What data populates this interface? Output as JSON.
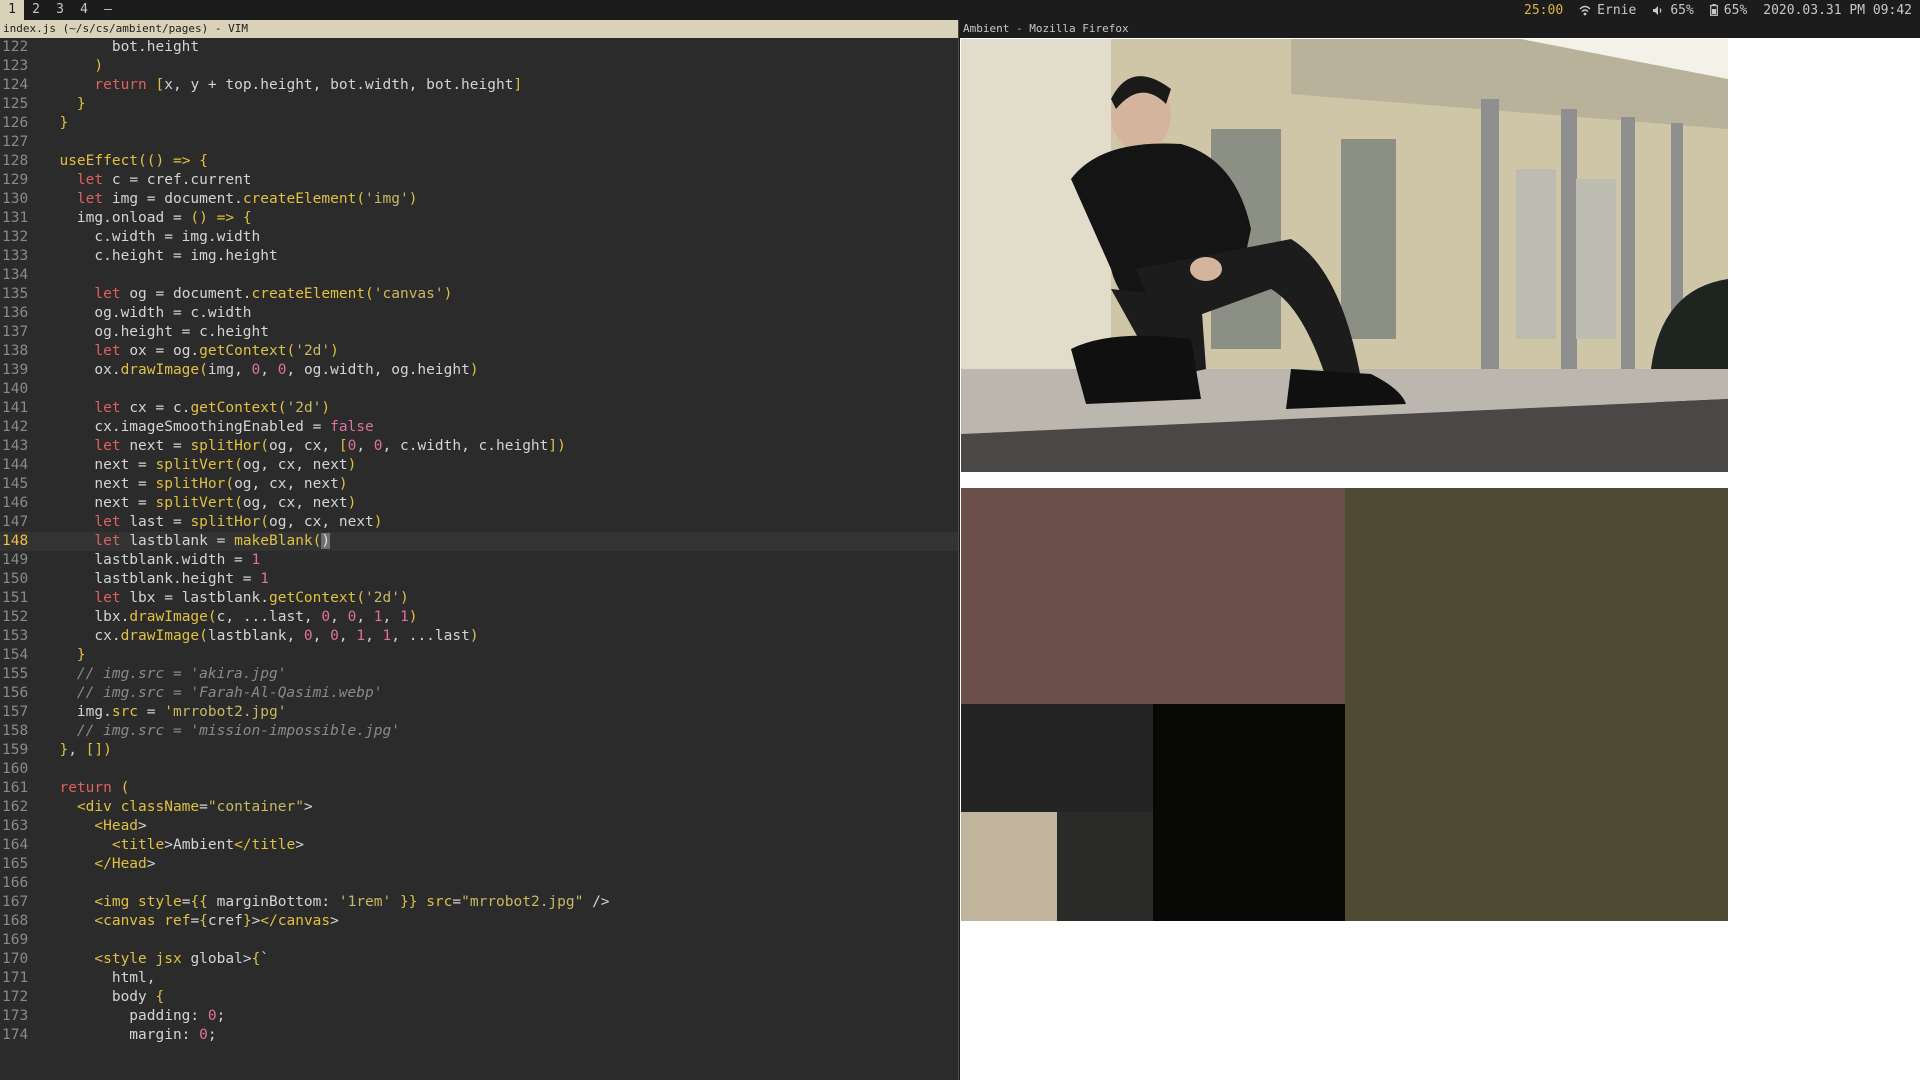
{
  "topbar": {
    "workspaces": [
      "1",
      "2",
      "3",
      "4",
      "–"
    ],
    "timer": "25:00",
    "wifi": "Ernie",
    "volume": "65%",
    "battery": "65%",
    "datetime": "2020.03.31  PM 09:42"
  },
  "vim": {
    "title": "index.js (~/s/cs/ambient/pages) - VIM",
    "current_line": "148"
  },
  "firefox": {
    "title": "Ambient - Mozilla Firefox",
    "image_alt": "mrrobot2.jpg"
  },
  "colors": {
    "accent_yellow": "#d8b545",
    "titlebar_light": "#d9d2b8",
    "block_rose": "#6b4f4a",
    "block_olive": "#4f4a33",
    "block_dark": "#242424",
    "block_black": "#080806",
    "block_beige": "#c0b49c",
    "block_charcoal": "#2a2a28"
  },
  "code_lines": [
    {
      "n": "122",
      "t": "        bot.height"
    },
    {
      "n": "123",
      "t": "      )"
    },
    {
      "n": "124",
      "t": "      return [x, y + top.height, bot.width, bot.height]"
    },
    {
      "n": "125",
      "t": "    }"
    },
    {
      "n": "126",
      "t": "  }"
    },
    {
      "n": "127",
      "t": ""
    },
    {
      "n": "128",
      "t": "  useEffect(() => {"
    },
    {
      "n": "129",
      "t": "    let c = cref.current"
    },
    {
      "n": "130",
      "t": "    let img = document.createElement('img')"
    },
    {
      "n": "131",
      "t": "    img.onload = () => {"
    },
    {
      "n": "132",
      "t": "      c.width = img.width"
    },
    {
      "n": "133",
      "t": "      c.height = img.height"
    },
    {
      "n": "134",
      "t": ""
    },
    {
      "n": "135",
      "t": "      let og = document.createElement('canvas')"
    },
    {
      "n": "136",
      "t": "      og.width = c.width"
    },
    {
      "n": "137",
      "t": "      og.height = c.height"
    },
    {
      "n": "138",
      "t": "      let ox = og.getContext('2d')"
    },
    {
      "n": "139",
      "t": "      ox.drawImage(img, 0, 0, og.width, og.height)"
    },
    {
      "n": "140",
      "t": ""
    },
    {
      "n": "141",
      "t": "      let cx = c.getContext('2d')"
    },
    {
      "n": "142",
      "t": "      cx.imageSmoothingEnabled = false"
    },
    {
      "n": "143",
      "t": "      let next = splitHor(og, cx, [0, 0, c.width, c.height])"
    },
    {
      "n": "144",
      "t": "      next = splitVert(og, cx, next)"
    },
    {
      "n": "145",
      "t": "      next = splitHor(og, cx, next)"
    },
    {
      "n": "146",
      "t": "      next = splitVert(og, cx, next)"
    },
    {
      "n": "147",
      "t": "      let last = splitHor(og, cx, next)"
    },
    {
      "n": "148",
      "t": "      let lastblank = makeBlank()"
    },
    {
      "n": "149",
      "t": "      lastblank.width = 1"
    },
    {
      "n": "150",
      "t": "      lastblank.height = 1"
    },
    {
      "n": "151",
      "t": "      let lbx = lastblank.getContext('2d')"
    },
    {
      "n": "152",
      "t": "      lbx.drawImage(c, ...last, 0, 0, 1, 1)"
    },
    {
      "n": "153",
      "t": "      cx.drawImage(lastblank, 0, 0, 1, 1, ...last)"
    },
    {
      "n": "154",
      "t": "    }"
    },
    {
      "n": "155",
      "t": "    // img.src = 'akira.jpg'"
    },
    {
      "n": "156",
      "t": "    // img.src = 'Farah-Al-Qasimi.webp'"
    },
    {
      "n": "157",
      "t": "    img.src = 'mrrobot2.jpg'"
    },
    {
      "n": "158",
      "t": "    // img.src = 'mission-impossible.jpg'"
    },
    {
      "n": "159",
      "t": "  }, [])"
    },
    {
      "n": "160",
      "t": ""
    },
    {
      "n": "161",
      "t": "  return ("
    },
    {
      "n": "162",
      "t": "    <div className=\"container\">"
    },
    {
      "n": "163",
      "t": "      <Head>"
    },
    {
      "n": "164",
      "t": "        <title>Ambient</title>"
    },
    {
      "n": "165",
      "t": "      </Head>"
    },
    {
      "n": "166",
      "t": ""
    },
    {
      "n": "167",
      "t": "      <img style={{ marginBottom: '1rem' }} src=\"mrrobot2.jpg\" />"
    },
    {
      "n": "168",
      "t": "      <canvas ref={cref}></canvas>"
    },
    {
      "n": "169",
      "t": ""
    },
    {
      "n": "170",
      "t": "      <style jsx global>{`"
    },
    {
      "n": "171",
      "t": "        html,"
    },
    {
      "n": "172",
      "t": "        body {"
    },
    {
      "n": "173",
      "t": "          padding: 0;"
    },
    {
      "n": "174",
      "t": "          margin: 0;"
    }
  ]
}
